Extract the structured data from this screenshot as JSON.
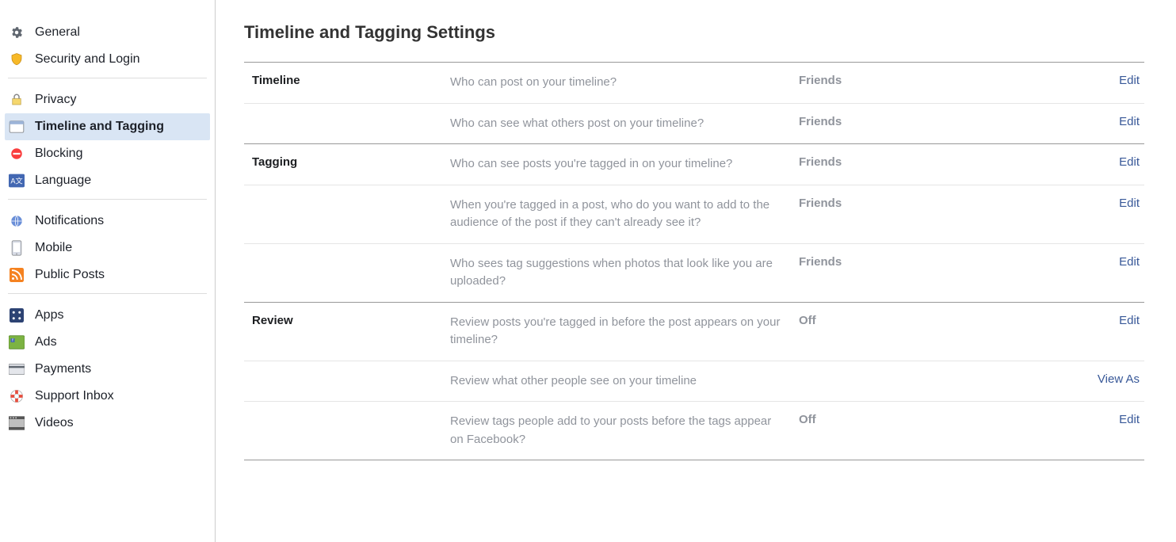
{
  "sidebar": {
    "groups": [
      [
        {
          "label": "General",
          "icon": "gear",
          "selected": false
        },
        {
          "label": "Security and Login",
          "icon": "shield",
          "selected": false
        }
      ],
      [
        {
          "label": "Privacy",
          "icon": "lock",
          "selected": false
        },
        {
          "label": "Timeline and Tagging",
          "icon": "timeline",
          "selected": true
        },
        {
          "label": "Blocking",
          "icon": "block",
          "selected": false
        },
        {
          "label": "Language",
          "icon": "language",
          "selected": false
        }
      ],
      [
        {
          "label": "Notifications",
          "icon": "globe",
          "selected": false
        },
        {
          "label": "Mobile",
          "icon": "mobile",
          "selected": false
        },
        {
          "label": "Public Posts",
          "icon": "rss",
          "selected": false
        }
      ],
      [
        {
          "label": "Apps",
          "icon": "apps",
          "selected": false
        },
        {
          "label": "Ads",
          "icon": "ads",
          "selected": false
        },
        {
          "label": "Payments",
          "icon": "payments",
          "selected": false
        },
        {
          "label": "Support Inbox",
          "icon": "support",
          "selected": false
        },
        {
          "label": "Videos",
          "icon": "videos",
          "selected": false
        }
      ]
    ]
  },
  "page": {
    "title": "Timeline and Tagging Settings"
  },
  "sections": [
    {
      "label": "Timeline",
      "rows": [
        {
          "question": "Who can post on your timeline?",
          "value": "Friends",
          "action": "Edit"
        },
        {
          "question": "Who can see what others post on your timeline?",
          "value": "Friends",
          "action": "Edit"
        }
      ]
    },
    {
      "label": "Tagging",
      "rows": [
        {
          "question": "Who can see posts you're tagged in on your timeline?",
          "value": "Friends",
          "action": "Edit"
        },
        {
          "question": "When you're tagged in a post, who do you want to add to the audience of the post if they can't already see it?",
          "value": "Friends",
          "action": "Edit"
        },
        {
          "question": "Who sees tag suggestions when photos that look like you are uploaded?",
          "value": "Friends",
          "action": "Edit"
        }
      ]
    },
    {
      "label": "Review",
      "rows": [
        {
          "question": "Review posts you're tagged in before the post appears on your timeline?",
          "value": "Off",
          "action": "Edit"
        },
        {
          "question": "Review what other people see on your timeline",
          "value": "",
          "action": "View As"
        },
        {
          "question": "Review tags people add to your posts before the tags appear on Facebook?",
          "value": "Off",
          "action": "Edit"
        }
      ]
    }
  ]
}
